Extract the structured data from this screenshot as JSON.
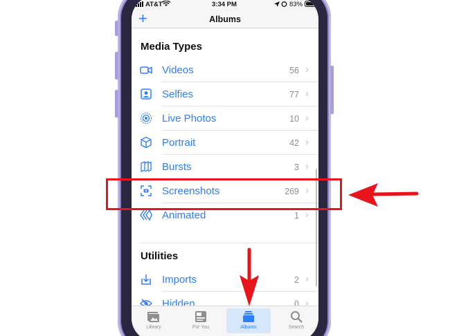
{
  "status_bar": {
    "carrier": "AT&T",
    "time": "3:34 PM",
    "battery": "83%"
  },
  "nav": {
    "add_label": "+",
    "title": "Albums"
  },
  "sections": [
    {
      "title": "Media Types"
    },
    {
      "title": "Utilities"
    }
  ],
  "media_types": [
    {
      "label": "Videos",
      "count": "56",
      "icon": "video-icon"
    },
    {
      "label": "Selfies",
      "count": "77",
      "icon": "selfie-icon"
    },
    {
      "label": "Live Photos",
      "count": "10",
      "icon": "live-photo-icon"
    },
    {
      "label": "Portrait",
      "count": "42",
      "icon": "portrait-cube-icon"
    },
    {
      "label": "Bursts",
      "count": "3",
      "icon": "bursts-icon"
    },
    {
      "label": "Screenshots",
      "count": "269",
      "icon": "screenshot-icon"
    },
    {
      "label": "Animated",
      "count": "1",
      "icon": "animated-icon"
    }
  ],
  "utilities": [
    {
      "label": "Imports",
      "count": "2",
      "icon": "import-icon"
    },
    {
      "label": "Hidden",
      "count": "0",
      "icon": "hidden-eye-icon"
    }
  ],
  "tabs": [
    {
      "label": "Library",
      "icon": "library-icon",
      "active": false
    },
    {
      "label": "For You",
      "icon": "for-you-icon",
      "active": false
    },
    {
      "label": "Albums",
      "icon": "albums-icon",
      "active": true
    },
    {
      "label": "Search",
      "icon": "search-icon",
      "active": false
    }
  ],
  "chevron": "›",
  "colors": {
    "accent": "#2f7ef6",
    "annotation": "#e8141b",
    "phone_frame": "#a99ee0"
  }
}
